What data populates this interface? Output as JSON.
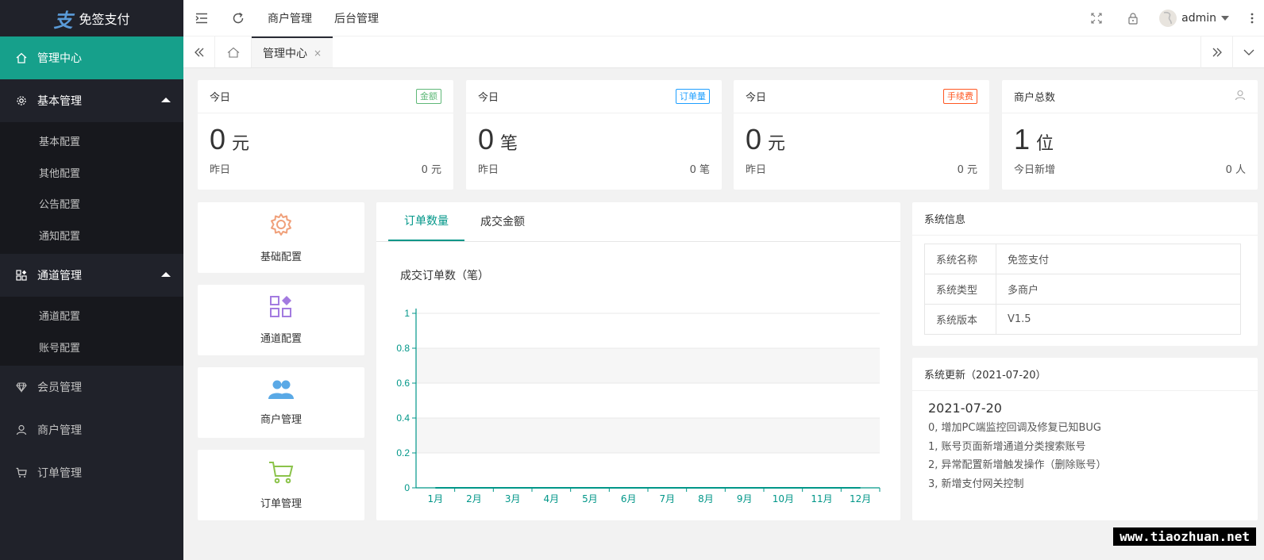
{
  "app": {
    "title": "免签支付"
  },
  "sidebar": {
    "items": [
      {
        "label": "管理中心",
        "icon": "home-icon"
      },
      {
        "label": "基本管理",
        "icon": "gear-icon",
        "children": [
          "基本配置",
          "其他配置",
          "公告配置",
          "通知配置"
        ]
      },
      {
        "label": "通道管理",
        "icon": "apps-icon",
        "children": [
          "通道配置",
          "账号配置"
        ]
      },
      {
        "label": "会员管理",
        "icon": "diamond-icon"
      },
      {
        "label": "商户管理",
        "icon": "user-icon"
      },
      {
        "label": "订单管理",
        "icon": "cart-icon"
      }
    ]
  },
  "header": {
    "links": [
      "商户管理",
      "后台管理"
    ],
    "user": "admin"
  },
  "tabs": {
    "active": "管理中心",
    "close": "×"
  },
  "stats": [
    {
      "title": "今日",
      "badge": "金额",
      "badge_color": "#5fb878",
      "value": "0",
      "unit": "元",
      "foot_label": "昨日",
      "foot_value": "0 元"
    },
    {
      "title": "今日",
      "badge": "订单量",
      "badge_color": "#1e9fff",
      "value": "0",
      "unit": "笔",
      "foot_label": "昨日",
      "foot_value": "0 笔"
    },
    {
      "title": "今日",
      "badge": "手续费",
      "badge_color": "#ff5722",
      "value": "0",
      "unit": "元",
      "foot_label": "昨日",
      "foot_value": "0 元"
    },
    {
      "title": "商户总数",
      "badge": "",
      "value": "1",
      "unit": "位",
      "foot_label": "今日新增",
      "foot_value": "0 人"
    }
  ],
  "quick_links": [
    {
      "label": "基础配置",
      "icon": "gear-icon",
      "color": "#f0a07a"
    },
    {
      "label": "通道配置",
      "icon": "apps-icon",
      "color": "#a37be0"
    },
    {
      "label": "商户管理",
      "icon": "users-icon",
      "color": "#5aa9e6"
    },
    {
      "label": "订单管理",
      "icon": "cart-icon",
      "color": "#8bc34a"
    }
  ],
  "chart_panel": {
    "tabs": [
      "订单数量",
      "成交金额"
    ],
    "title": "成交订单数（笔）"
  },
  "chart_data": {
    "type": "line",
    "title": "成交订单数（笔）",
    "categories": [
      "1月",
      "2月",
      "3月",
      "4月",
      "5月",
      "6月",
      "7月",
      "8月",
      "9月",
      "10月",
      "11月",
      "12月"
    ],
    "yticks": [
      "0",
      "0.2",
      "0.4",
      "0.6",
      "0.8",
      "1"
    ],
    "ylim": [
      0,
      1
    ],
    "series": [
      {
        "values": [
          0,
          0,
          0,
          0,
          0,
          0,
          0,
          0,
          0,
          0,
          0,
          0
        ]
      }
    ],
    "color": "#009688"
  },
  "sysinfo": {
    "title": "系统信息",
    "rows": [
      {
        "k": "系统名称",
        "v": "免签支付"
      },
      {
        "k": "系统类型",
        "v": "多商户"
      },
      {
        "k": "系统版本",
        "v": "V1.5"
      }
    ]
  },
  "update": {
    "title": "系统更新（2021-07-20）",
    "date": "2021-07-20",
    "lines": [
      "0, 增加PC端监控回调及修复已知BUG",
      "1, 账号页面新增通道分类搜索账号",
      "2, 异常配置新增触发操作（删除账号）",
      "3, 新增支付网关控制"
    ]
  },
  "watermark": "www.tiaozhuan.net"
}
